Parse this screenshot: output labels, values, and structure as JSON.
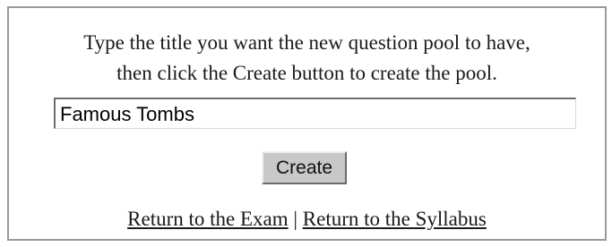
{
  "instructions": {
    "line1": "Type the title you want the new question pool to have,",
    "line2": "then click the Create button to create the pool."
  },
  "title_input": {
    "value": "Famous Tombs"
  },
  "create_button": {
    "label": "Create"
  },
  "links": {
    "return_exam": "Return to the Exam",
    "separator": "|",
    "return_syllabus": "Return to the Syllabus"
  }
}
